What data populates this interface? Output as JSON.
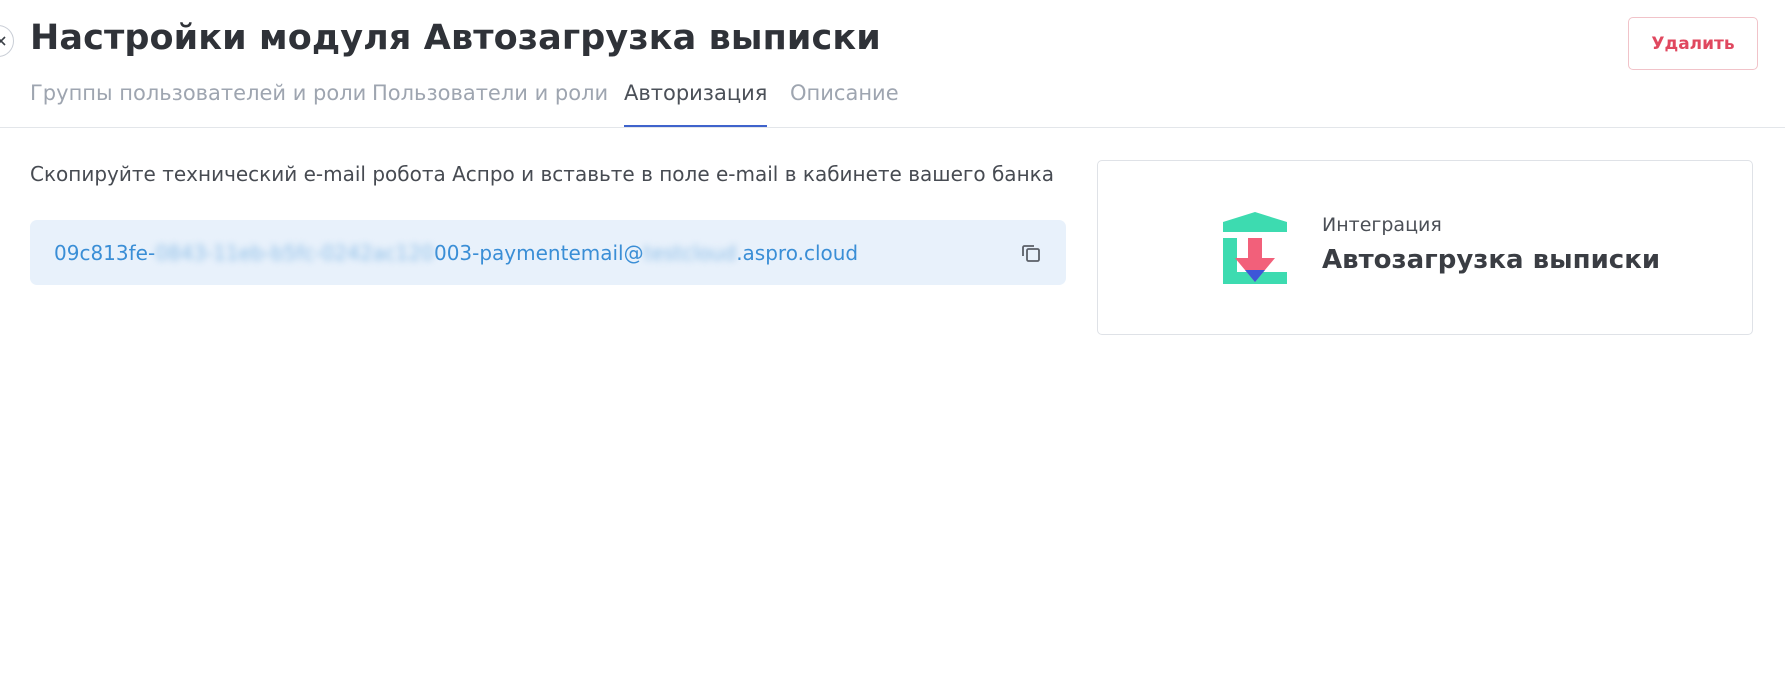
{
  "header": {
    "title": "Настройки модуля Автозагрузка выписки",
    "back_icon": "close-icon",
    "delete_label": "Удалить"
  },
  "tabs": [
    {
      "label": "Группы пользователей и роли",
      "active": false
    },
    {
      "label": "Пользователи и роли",
      "active": false
    },
    {
      "label": "Авторизация",
      "active": true
    },
    {
      "label": "Описание",
      "active": false
    }
  ],
  "authorization": {
    "instruction": "Скопируйте технический e-mail робота Аспро и вставьте в поле e-mail в кабинете вашего банка",
    "email": {
      "prefix": "09c813fe-",
      "blurred_part1": "0843-11eb-b5fc-0242ac120",
      "middle": "003-paymentemail@",
      "blurred_part2": "testcloud",
      "suffix": ".aspro.cloud"
    },
    "copy_icon": "copy-icon"
  },
  "integration_card": {
    "caption": "Интеграция",
    "name": "Автозагрузка выписки",
    "icon": "bank-download-icon"
  },
  "colors": {
    "accent": "#3f63cc",
    "link": "#3a8ed6",
    "danger": "#e0485f",
    "logo_green": "#3ddbb0",
    "logo_pink": "#f2607a",
    "logo_blue": "#3d56d8"
  }
}
